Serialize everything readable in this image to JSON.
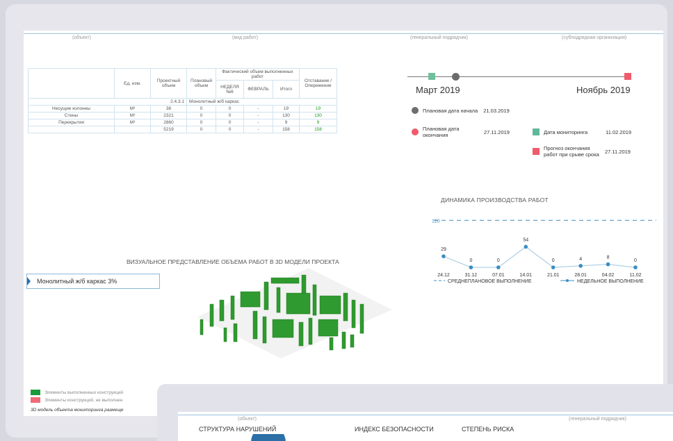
{
  "header": {
    "object": "(объект)",
    "work_type": "(вид работ)",
    "general_contractor": "(генеральный подрядчик)",
    "subcontractor": "(субподрядная организация)"
  },
  "table": {
    "col_unit": "Ед. изм.",
    "col_project": "Проектный объем",
    "col_plan": "Плановый объем",
    "col_actual_group": "Фактический объем выполненных работ",
    "col_week": "НЕДЕЛЯ №6",
    "col_month": "ФЕВРАЛЬ",
    "col_total": "Итого",
    "col_lag": "Отставание /Опережение",
    "section_code": "2.4.3.1",
    "section_name": "Монолитный ж/б каркас",
    "rows": [
      {
        "name": "Несущие колонны",
        "unit": "М³",
        "project": "38",
        "plan": "0",
        "week": "0",
        "month": "-",
        "total": "19",
        "lag": "19"
      },
      {
        "name": "Стены",
        "unit": "М³",
        "project": "2321",
        "plan": "0",
        "week": "0",
        "month": "-",
        "total": "130",
        "lag": "130"
      },
      {
        "name": "Перекрытия",
        "unit": "М³",
        "project": "2860",
        "plan": "0",
        "week": "0",
        "month": "-",
        "total": "9",
        "lag": "9"
      }
    ],
    "totals": {
      "project": "5219",
      "plan": "0",
      "week": "0",
      "month": "-",
      "total": "158",
      "lag": "158"
    }
  },
  "timeline": {
    "start_label": "Март 2019",
    "end_label": "Ноябрь 2019",
    "planned_start_label": "Плановая дата начала",
    "planned_start_date": "21.03.2019",
    "planned_end_label": "Плановая дата окончания",
    "planned_end_date": "27.11.2019",
    "monitoring_label": "Дата мониторинга",
    "monitoring_date": "11.02.2019",
    "forecast_label": "Прогноз окончания работ при срыве срока",
    "forecast_date": "27.11.2019",
    "colors": {
      "start": "#6e6e6e",
      "end": "#f05a6a",
      "monitoring": "#5fb89a",
      "forecast": "#f05a6a",
      "marker_start": "#6fbf9a"
    }
  },
  "chart_data": {
    "type": "line",
    "title": "ДИНАМИКА ПРОИЗВОДСТВА РАБОТ",
    "categories": [
      "24.12",
      "31.12",
      "07.01",
      "14.01",
      "21.01",
      "28.01",
      "04.02",
      "11.02"
    ],
    "series": [
      {
        "name": "НЕДЕЛЬНОЕ ВЫПОЛНЕНИЕ",
        "values": [
          29,
          0,
          0,
          54,
          0,
          4,
          8,
          0
        ],
        "color": "#3a8cc1"
      },
      {
        "name": "СРЕДНЕПЛАНОВОЕ ВЫПОЛНЕНИЕ",
        "values": [
          120,
          120,
          120,
          120,
          120,
          120,
          120,
          120
        ],
        "color": "#3a8cc1",
        "style": "dashed"
      }
    ],
    "ref_label": "120",
    "ylim": [
      0,
      130
    ]
  },
  "visual": {
    "title": "ВИЗУАЛЬНОЕ ПРЕДСТАВЛЕНИЕ ОБЪЕМА РАБОТ В 3D МОДЕЛИ ПРОЕКТА",
    "selector_value": "Монолитный ж/б каркас 3%",
    "legend_done": "Элементы выполненных конструкций",
    "legend_not_done": "Элементы конструкций, не выполнен",
    "footer_note": "3D модель объекта мониторинга размеще",
    "colors": {
      "done": "#1a9a3a",
      "not_done": "#f06a78",
      "model": "#2f9a2f"
    }
  },
  "front_panel": {
    "object": "(объект)",
    "general_contractor": "(генеральный подрядчик)",
    "violations_title": "СТРУКТУРА НАРУШЕНИЙ",
    "safety_index": "ИНДЕКС БЕЗОПАСНОСТИ",
    "risk_level": "СТЕПЕНЬ РИСКА"
  }
}
